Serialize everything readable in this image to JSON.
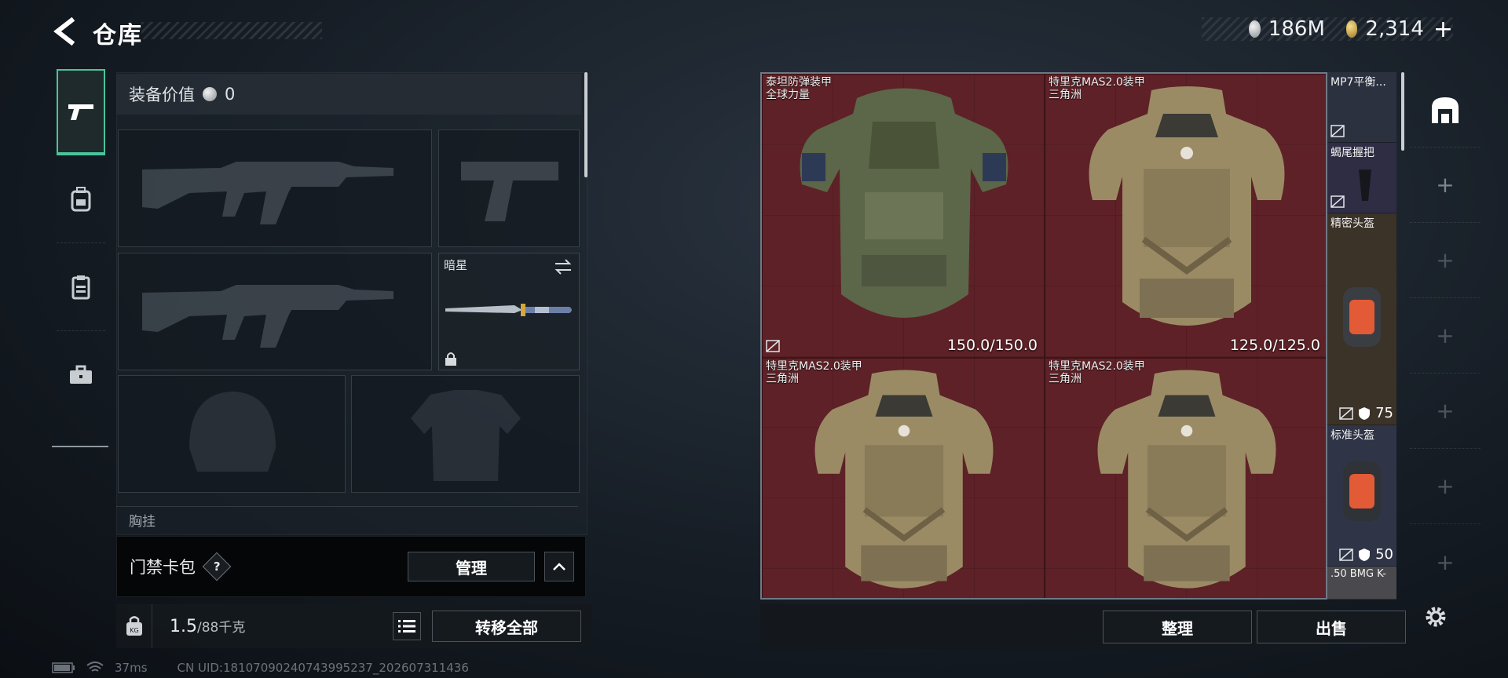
{
  "header": {
    "title": "仓库",
    "currency_silver": "186M",
    "currency_gold": "2,314",
    "currency_plus": "+"
  },
  "categories": [
    {
      "name": "weapons",
      "icon": "pistol-icon"
    },
    {
      "name": "equipment",
      "icon": "backpack-icon"
    },
    {
      "name": "consumables",
      "icon": "clipboard-icon"
    },
    {
      "name": "toolbox",
      "icon": "briefcase-icon"
    }
  ],
  "equipment": {
    "value_label": "装备价值",
    "value": "0",
    "melee_name": "暗星",
    "chest_label": "胸挂"
  },
  "keycard": {
    "label": "门禁卡包",
    "help": "?",
    "manage_button": "管理"
  },
  "capacity": {
    "current": "1.5",
    "max": "/88千克",
    "kg_badge": "KG",
    "transfer_all_button": "转移全部"
  },
  "status": {
    "latency": "37ms",
    "uid": "CN UID:18107090240743995237_202607311436"
  },
  "stash": {
    "items": [
      {
        "name_line1": "泰坦防弹装甲",
        "name_line2": "全球力量",
        "durability": "150.0/150.0",
        "color": "green"
      },
      {
        "name_line1": "特里克MAS2.0装甲",
        "name_line2": "三角洲",
        "durability": "125.0/125.0",
        "color": "camo"
      },
      {
        "name_line1": "特里克MAS2.0装甲",
        "name_line2": "三角洲",
        "durability": "",
        "color": "camo"
      },
      {
        "name_line1": "特里克MAS2.0装甲",
        "name_line2": "三角洲",
        "durability": "",
        "color": "camo"
      }
    ],
    "side_items": [
      {
        "name": "MP7平衡..."
      },
      {
        "name": "蝎尾握把"
      },
      {
        "name": "精密头盔",
        "armor": "75"
      },
      {
        "name": "标准头盔",
        "armor": "50"
      },
      {
        "name": ".50 BMG K-"
      }
    ],
    "sort_button": "整理",
    "sell_button": "出售"
  },
  "colors": {
    "accent_green": "#4ac59a",
    "stash_bg": "#5a2026"
  }
}
